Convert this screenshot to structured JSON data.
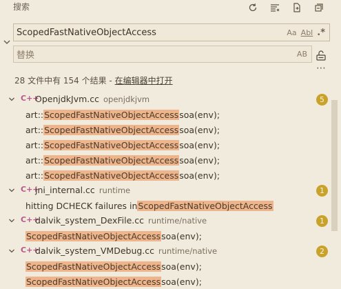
{
  "header": {
    "title": "搜索",
    "icons": [
      "refresh-icon",
      "clear-results-icon",
      "new-search-editor-icon",
      "collapse-all-icon"
    ]
  },
  "search": {
    "value": "ScopedFastNativeObjectAccess",
    "opt_case": "Aa",
    "opt_word": "Abl",
    "opt_regex": ".*"
  },
  "replace": {
    "placeholder": "替换",
    "opt_preserve_case": "AB"
  },
  "summary": {
    "text": "28 文件中有 154 个结果 - ",
    "link": "在编辑器中打开"
  },
  "results": [
    {
      "lang": "C++",
      "file": "OpenjdkJvm.cc",
      "path": "openjdkjvm",
      "count": "5",
      "matches": [
        {
          "pre": "art::",
          "hit": "ScopedFastNativeObjectAccess",
          "post": " soa(env);"
        },
        {
          "pre": "art::",
          "hit": "ScopedFastNativeObjectAccess",
          "post": " soa(env);"
        },
        {
          "pre": "art::",
          "hit": "ScopedFastNativeObjectAccess",
          "post": " soa(env);"
        },
        {
          "pre": "art::",
          "hit": "ScopedFastNativeObjectAccess",
          "post": " soa(env);"
        },
        {
          "pre": "art::",
          "hit": "ScopedFastNativeObjectAccess",
          "post": " soa(env);"
        }
      ]
    },
    {
      "lang": "C++",
      "file": "jni_internal.cc",
      "path": "runtime",
      "count": "1",
      "matches": [
        {
          "pre": "hitting DCHECK failures in ",
          "hit": "ScopedFastNativeObjectAccess",
          "post": ""
        }
      ]
    },
    {
      "lang": "C++",
      "file": "dalvik_system_DexFile.cc",
      "path": "runtime/native",
      "count": "1",
      "matches": [
        {
          "pre": "",
          "hit": "ScopedFastNativeObjectAccess",
          "post": " soa(env);"
        }
      ]
    },
    {
      "lang": "C++",
      "file": "dalvik_system_VMDebug.cc",
      "path": "runtime/native",
      "count": "2",
      "matches": [
        {
          "pre": "",
          "hit": "ScopedFastNativeObjectAccess",
          "post": " soa(env);"
        },
        {
          "pre": "",
          "hit": "ScopedFastNativeObjectAccess",
          "post": " soa(env);"
        }
      ]
    }
  ],
  "colors": {
    "background": "#f1ebde",
    "match_highlight": "#eeb48c",
    "badge": "#c9a22b",
    "cpp_icon": "#b7568a"
  }
}
